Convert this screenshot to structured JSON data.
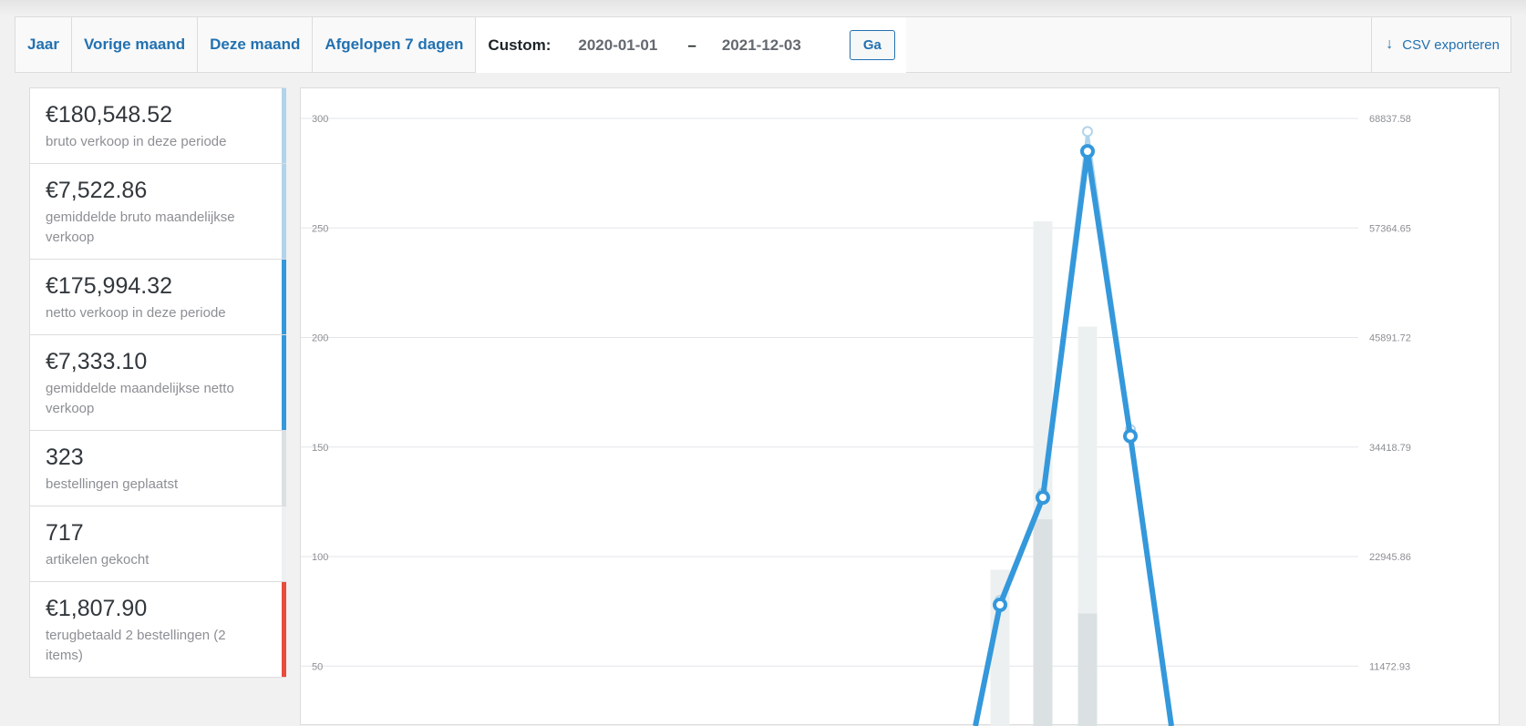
{
  "toolbar": {
    "tabs": [
      "Jaar",
      "Vorige maand",
      "Deze maand",
      "Afgelopen 7 dagen"
    ],
    "custom_label": "Custom:",
    "date_from": "2020-01-01",
    "date_sep": "–",
    "date_to": "2021-12-03",
    "go_label": "Ga",
    "export_label": "CSV exporteren"
  },
  "legend": [
    {
      "value": "€180,548.52",
      "label": "bruto verkoop in deze periode",
      "color": "#b1d4ea"
    },
    {
      "value": "€7,522.86",
      "label": "gemiddelde bruto maandelijkse verkoop",
      "color": "#b1d4ea"
    },
    {
      "value": "€175,994.32",
      "label": "netto verkoop in deze periode",
      "color": "#3498db"
    },
    {
      "value": "€7,333.10",
      "label": "gemiddelde maandelijkse netto verkoop",
      "color": "#3498db"
    },
    {
      "value": "323",
      "label": "bestellingen geplaatst",
      "color": "#dbe1e3"
    },
    {
      "value": "717",
      "label": "artikelen gekocht",
      "color": "#ecf0f1"
    },
    {
      "value": "€1,807.90",
      "label": "terugbetaald 2 bestellingen (2 items)",
      "color": "#e74c3c"
    }
  ],
  "chart_data": {
    "type": "bar",
    "title": "",
    "xlabel": "",
    "ylabel": "",
    "ylim": [
      0,
      300
    ],
    "yticks": [
      50,
      100,
      150,
      200,
      250,
      300
    ],
    "y2lim": [
      0,
      68837.58
    ],
    "y2ticks": [
      "11472.93",
      "22945.86",
      "34418.79",
      "45891.72",
      "57364.65",
      "68837.58"
    ],
    "grid": true,
    "x": [
      1,
      2,
      3,
      4
    ],
    "series": [
      {
        "type": "bar",
        "values": [
          94,
          253,
          205,
          0
        ],
        "color": "#ecf0f1"
      },
      {
        "type": "bar",
        "values": [
          0,
          117,
          74,
          0
        ],
        "color": "#dbe1e3"
      },
      {
        "type": "line",
        "values": [
          80000,
          129000,
          294000,
          158000
        ],
        "color": "#b1d4ea",
        "unit": "y1_scaled"
      },
      {
        "type": "line",
        "values": [
          78,
          127,
          285,
          155
        ],
        "color": "#3498db"
      }
    ]
  }
}
